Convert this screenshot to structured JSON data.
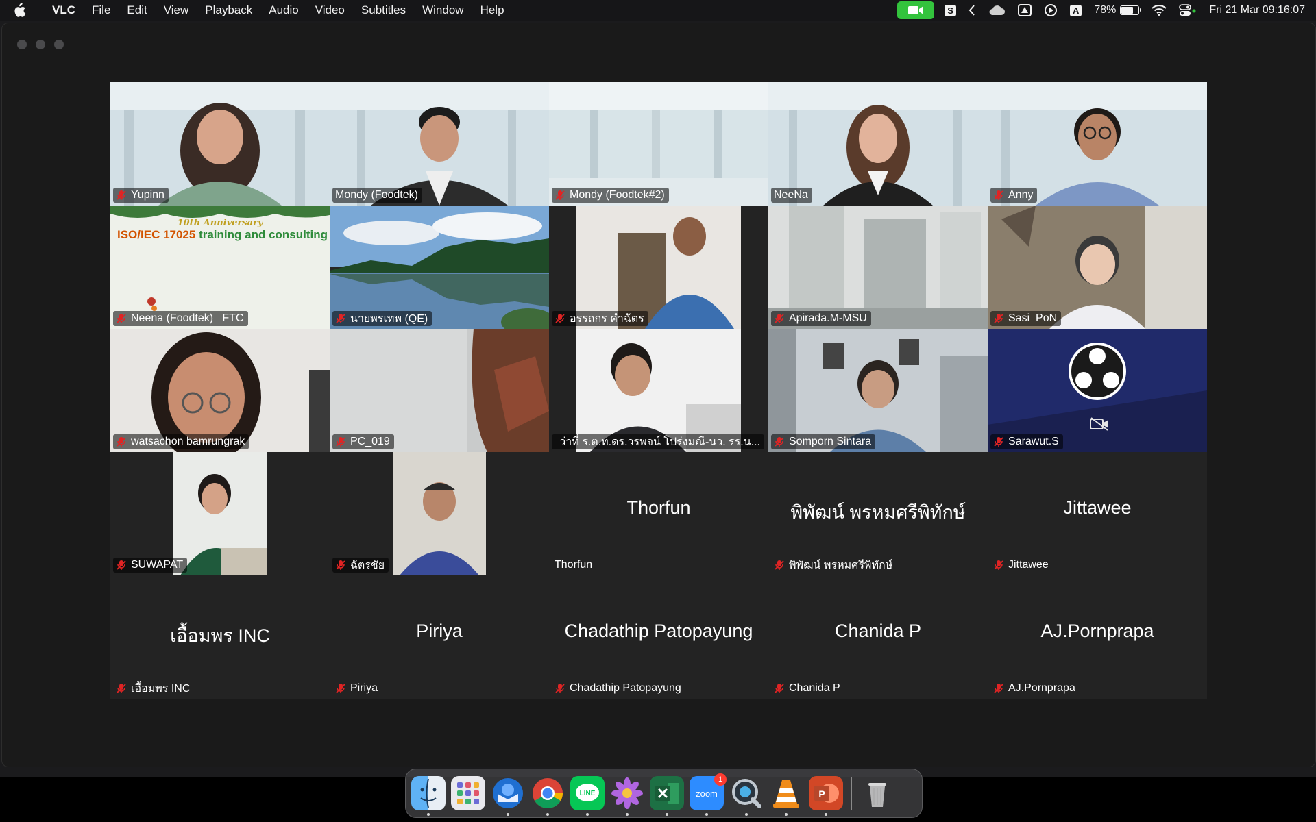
{
  "menubar": {
    "app_name": "VLC",
    "menus": [
      "File",
      "Edit",
      "View",
      "Playback",
      "Audio",
      "Video",
      "Subtitles",
      "Window",
      "Help"
    ],
    "status": {
      "s_icon": "S",
      "a_icon": "A",
      "battery": "78%",
      "battery_level": 0.78,
      "datetime": "Fri 21 Mar  09:16:07"
    }
  },
  "meeting": {
    "participants": [
      {
        "name": "Yupinn",
        "muted": true
      },
      {
        "name": "Mondy (Foodtek)",
        "muted": false
      },
      {
        "name": "Mondy (Foodtek#2)",
        "muted": true
      },
      {
        "name": "NeeNa",
        "muted": false,
        "active_speaker": true
      },
      {
        "name": "Anny",
        "muted": true
      },
      {
        "name": "Neena (Foodtek) _FTC",
        "muted": true
      },
      {
        "name": "นายพรเทพ (QE)",
        "muted": true
      },
      {
        "name": "อรรถกร คำฉัตร",
        "muted": true
      },
      {
        "name": "Apirada.M-MSU",
        "muted": true
      },
      {
        "name": "Sasi_PoN",
        "muted": true
      },
      {
        "name": "watsachon bamrungrak",
        "muted": true
      },
      {
        "name": "PC_019",
        "muted": true
      },
      {
        "name": "ว่าที่ ร.ต.ท.ดร.วรพจน์ โปร่งมณี-นว. รร.น...",
        "muted": true
      },
      {
        "name": "Somporn Sintara",
        "muted": true
      },
      {
        "name": "Sarawut.S",
        "muted": true
      },
      {
        "name": "SUWAPAT",
        "muted": true
      },
      {
        "name": "ฉัตรชัย",
        "muted": true
      },
      {
        "name": "Thorfun",
        "muted": false,
        "display": "Thorfun"
      },
      {
        "name": "พิพัฒน์ พรหมศรีพิทักษ์",
        "muted": true,
        "display": "พิพัฒน์ พรหมศรีพิทักษ์"
      },
      {
        "name": "Jittawee",
        "muted": true,
        "display": "Jittawee"
      },
      {
        "name": "เอื้อมพร INC",
        "muted": true,
        "display": "เอื้อมพร INC"
      },
      {
        "name": "Piriya",
        "muted": true,
        "display": "Piriya"
      },
      {
        "name": "Chadathip Patopayung",
        "muted": true,
        "display": "Chadathip Patopayung"
      },
      {
        "name": "Chanida P",
        "muted": true,
        "display": "Chanida P"
      },
      {
        "name": "AJ.Pornprapa",
        "muted": true,
        "display": "AJ.Pornprapa"
      }
    ],
    "banner": {
      "line1": "10th Anniversary",
      "line2a": "ISO/IEC 17025",
      "line2b": " training and consulting"
    }
  },
  "dock": {
    "apps": [
      "finder-icon",
      "launchpad-icon",
      "thunderbird-icon",
      "chrome-icon",
      "line-icon",
      "flower-app-icon",
      "excel-icon",
      "zoom-icon",
      "quicktime-icon",
      "vlc-icon",
      "powerpoint-icon",
      "trash-icon"
    ],
    "zoom_badge": "1",
    "zoom_label": "zoom"
  },
  "colors": {
    "active_speaker": "#2ecc40",
    "mute_red": "#e02424",
    "camera_green": "#33c33d"
  }
}
